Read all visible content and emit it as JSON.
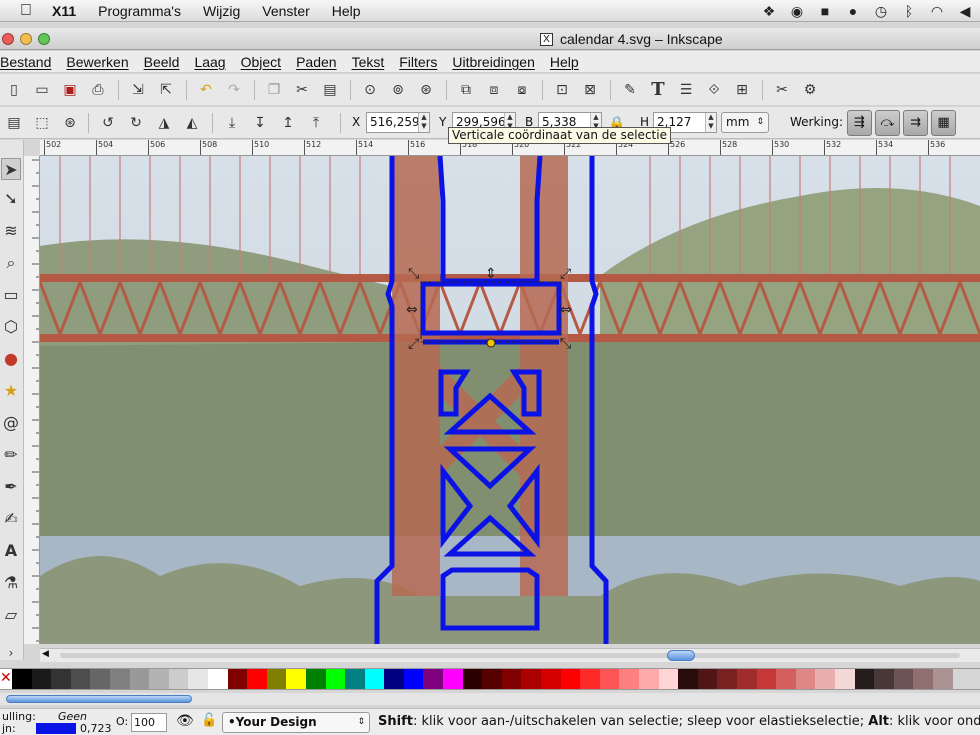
{
  "mac_menubar": {
    "app": "X11",
    "items": [
      "Programma's",
      "Wijzig",
      "Venster",
      "Help"
    ]
  },
  "window": {
    "title": "calendar 4.svg – Inkscape"
  },
  "menubar": {
    "items": [
      "Bestand",
      "Bewerken",
      "Beeld",
      "Laag",
      "Object",
      "Paden",
      "Tekst",
      "Filters",
      "Uitbreidingen",
      "Help"
    ]
  },
  "toolbar2": {
    "x_label": "X",
    "x_value": "516,259",
    "y_label": "Y",
    "y_value": "299,596",
    "w_label": "B",
    "w_value": "5,338",
    "h_label": "H",
    "h_value": "2,127",
    "unit": "mm",
    "werking_label": "Werking:"
  },
  "tooltip": "Verticale coördinaat van de selectie",
  "ruler": {
    "ticks": [
      "502",
      "504",
      "506",
      "508",
      "510",
      "512",
      "514",
      "516",
      "518",
      "520",
      "522",
      "524",
      "526",
      "528",
      "530",
      "532",
      "534",
      "536"
    ]
  },
  "statusbar": {
    "fill_label": "ulling:",
    "fill_value": "Geen",
    "stroke_label": "jn:",
    "stroke_width": "0,723",
    "opacity_label": "O:",
    "opacity_value": "100",
    "layer": "•Your Design",
    "message_bold1": "Shift",
    "message_part1": ": klik voor aan-/uitschakelen van selectie; sleep voor elastiekselectie; ",
    "message_bold2": "Alt",
    "message_part2": ": klik voor onders"
  },
  "colors": {
    "stroke": "#0b12e6",
    "bridge": "#b45a44",
    "selection": "#2a2a2a"
  }
}
